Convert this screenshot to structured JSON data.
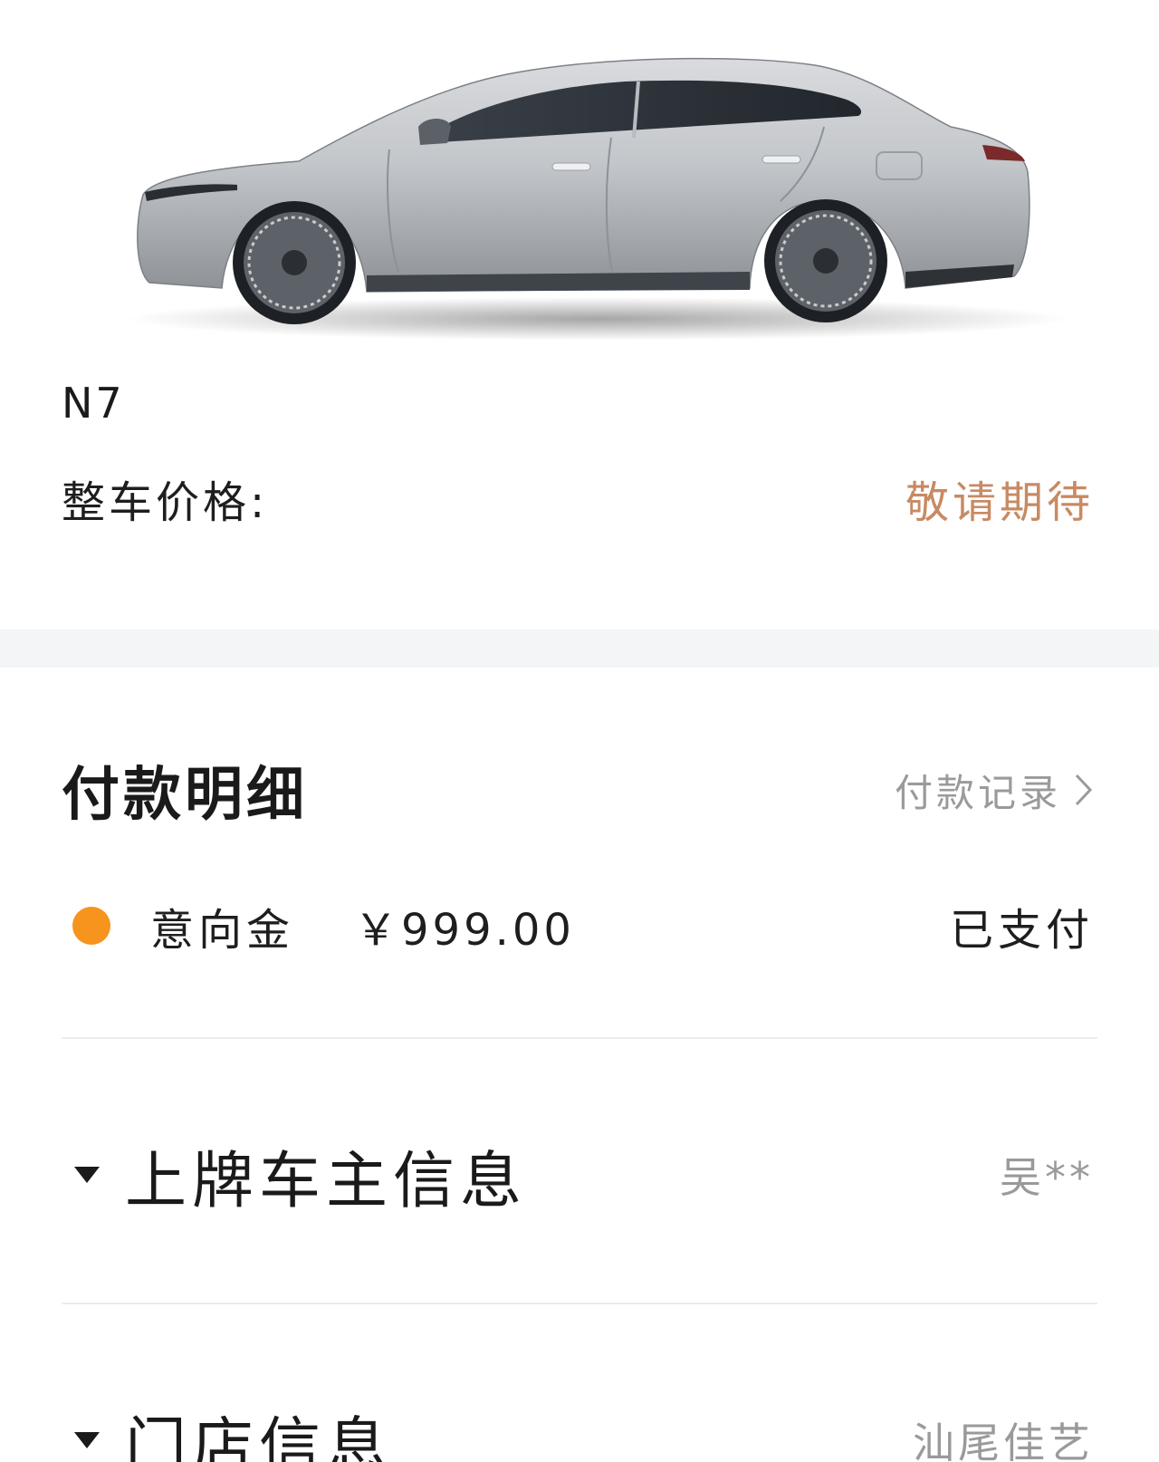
{
  "vehicle": {
    "model": "N7",
    "image": "car-side-view"
  },
  "price": {
    "label": "整车价格:",
    "value": "敬请期待"
  },
  "payment": {
    "title": "付款明细",
    "record_link": "付款记录",
    "items": [
      {
        "name": "意向金",
        "amount": "￥999.00",
        "status": "已支付",
        "dot_color": "#f7941d"
      }
    ]
  },
  "owner": {
    "title": "上牌车主信息",
    "value": "吴**"
  },
  "store": {
    "title": "门店信息",
    "value": "汕尾佳艺"
  },
  "colors": {
    "accent_price": "#c88a63",
    "status_dot": "#f7941d",
    "muted_text": "#9a9a9a"
  }
}
